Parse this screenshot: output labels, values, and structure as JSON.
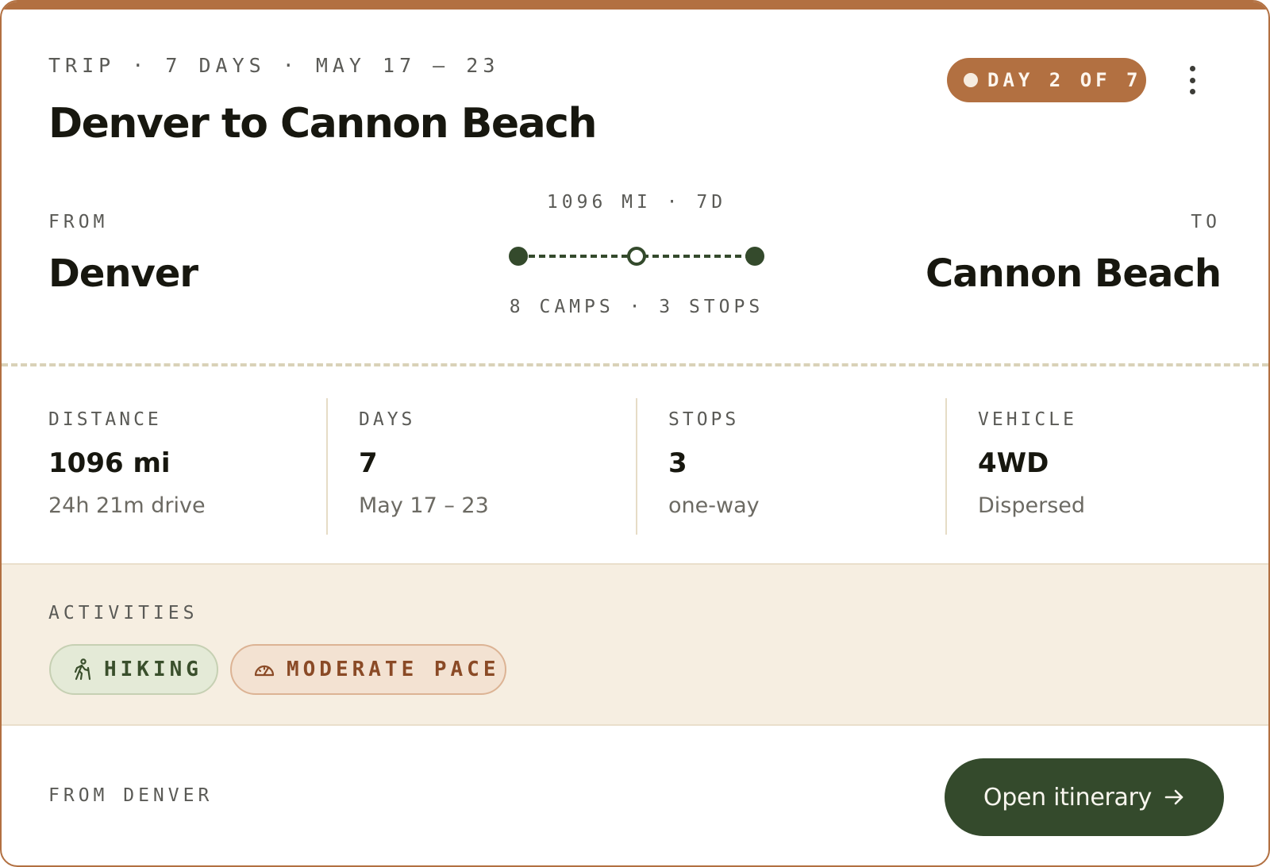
{
  "colors": {
    "accent": "#b27041",
    "forest": "#344a2c",
    "cream": "#f6eee1",
    "divider": "#d9d2b8"
  },
  "header": {
    "eyebrow": "TRIP · 7 DAYS · MAY 17 – 23",
    "title": "Denver to Cannon Beach",
    "day_badge": "DAY 2 OF 7",
    "menu_icon": "kebab-menu-icon"
  },
  "route": {
    "from_label": "FROM",
    "from_city": "Denver",
    "to_label": "TO",
    "to_city": "Cannon Beach",
    "summary_top": "1096 MI · 7D",
    "summary_bottom": "8 CAMPS · 3 STOPS",
    "progress_fraction": 0.5
  },
  "stats": [
    {
      "label": "DISTANCE",
      "value": "1096 mi",
      "sub": "24h 21m drive"
    },
    {
      "label": "DAYS",
      "value": "7",
      "sub": "May 17 – 23"
    },
    {
      "label": "STOPS",
      "value": "3",
      "sub": "one-way"
    },
    {
      "label": "VEHICLE",
      "value": "4WD",
      "sub": "Dispersed"
    }
  ],
  "activities": {
    "label": "ACTIVITIES",
    "chips": [
      {
        "label": "HIKING",
        "icon": "hiker-icon"
      },
      {
        "label": "MODERATE PACE",
        "icon": "speedometer-icon"
      }
    ]
  },
  "footer": {
    "label": "FROM DENVER",
    "cta_label": "Open itinerary",
    "cta_icon": "arrow-right-icon"
  }
}
